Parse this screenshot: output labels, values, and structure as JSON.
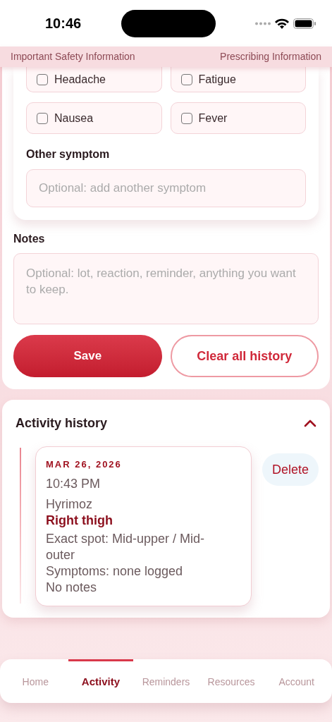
{
  "status_bar": {
    "time": "10:46"
  },
  "header_links": [
    "Important Safety Information",
    "Prescribing Information"
  ],
  "symptoms": [
    {
      "label": "Headache",
      "checked": false
    },
    {
      "label": "Fatigue",
      "checked": false
    },
    {
      "label": "Nausea",
      "checked": false
    },
    {
      "label": "Fever",
      "checked": false
    }
  ],
  "other_symptom": {
    "label": "Other symptom",
    "placeholder": "Optional: add another symptom"
  },
  "notes": {
    "label": "Notes",
    "placeholder": "Optional: lot, reaction, reminder, anything you want to keep."
  },
  "buttons": {
    "save": "Save",
    "clear": "Clear all history"
  },
  "activity_history": {
    "title": "Activity history",
    "expanded": true,
    "entries": [
      {
        "date": "MAR 26, 2026",
        "time": "10:43 PM",
        "product": "Hyrimoz",
        "site": "Right thigh",
        "spot": "Exact spot: Mid-upper / Mid-outer",
        "symptoms": "Symptoms: none logged",
        "notes": "No notes",
        "delete": "Delete"
      }
    ]
  },
  "tabs": [
    {
      "label": "Home",
      "selected": false
    },
    {
      "label": "Activity",
      "selected": true
    },
    {
      "label": "Reminders",
      "selected": false
    },
    {
      "label": "Resources",
      "selected": false
    },
    {
      "label": "Account",
      "selected": false
    }
  ]
}
